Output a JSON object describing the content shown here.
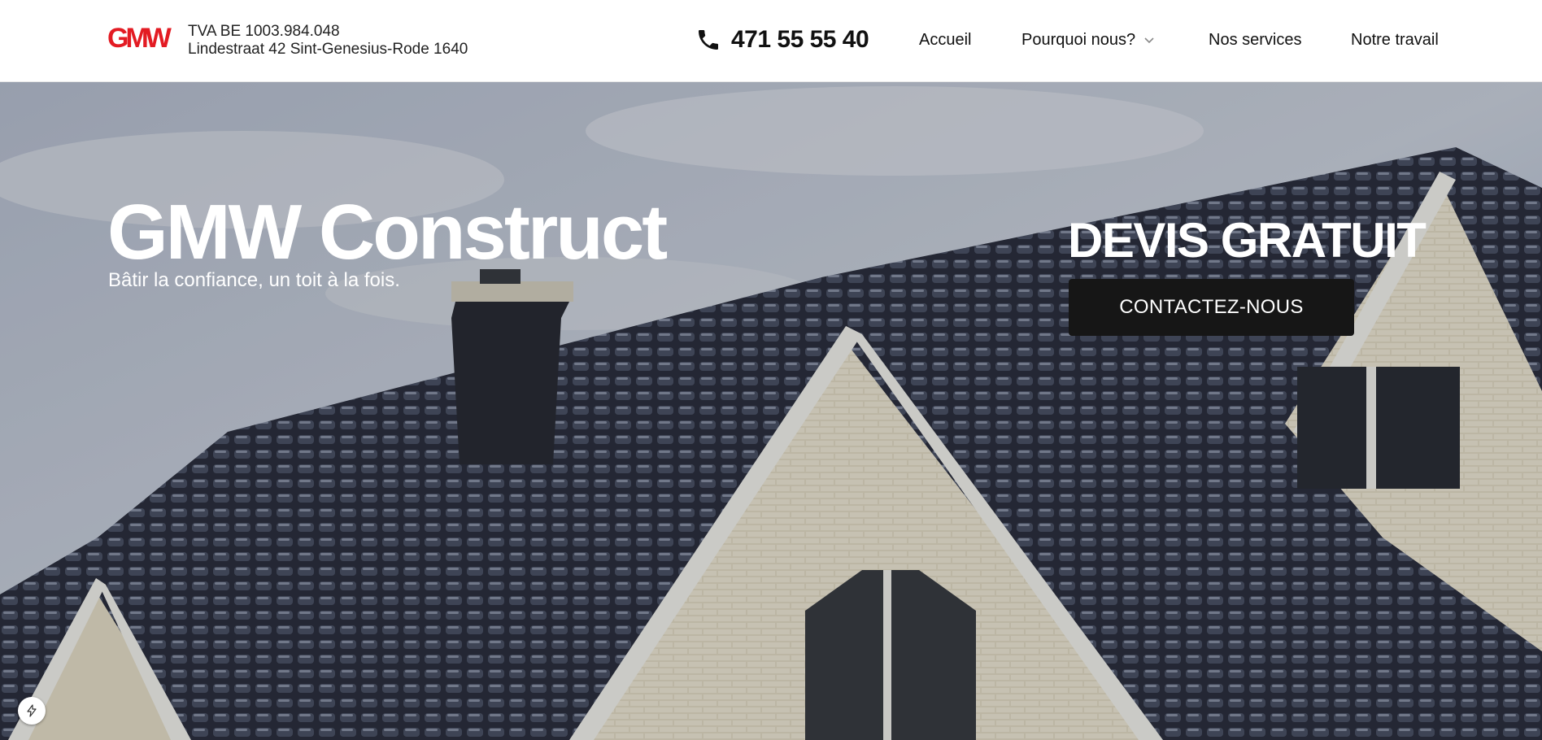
{
  "header": {
    "logo_text": "GMW",
    "vat": "TVA BE 1003.984.048",
    "address": "Lindestraat 42 Sint-Genesius-Rode 1640",
    "phone": "471 55 55 40",
    "nav": {
      "accueil": "Accueil",
      "pourquoi": "Pourquoi nous?",
      "services": "Nos services",
      "travail": "Notre travail"
    }
  },
  "hero": {
    "title": "GMW Construct",
    "tagline": "Bâtir la confiance, un toit à la fois.",
    "devis_title": "DEVIS GRATUIT",
    "cta_label": "CONTACTEZ-NOUS"
  },
  "colors": {
    "brand_red": "#e31b23",
    "cta_bg": "#161616"
  },
  "icons": [
    "phone-icon",
    "chevron-down-icon",
    "lightning-icon"
  ]
}
